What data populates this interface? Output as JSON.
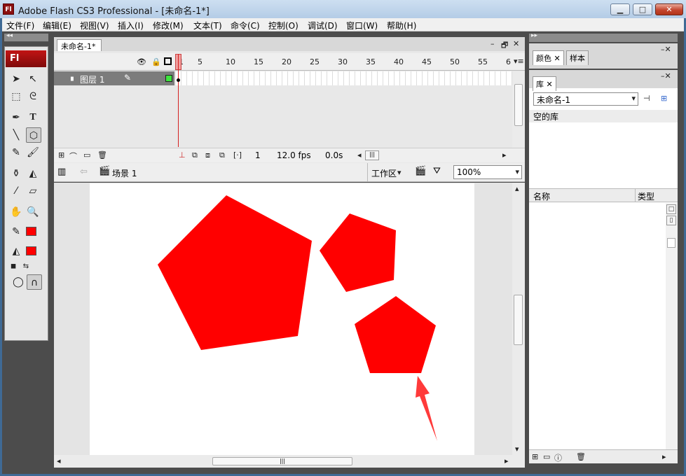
{
  "window": {
    "title": "Adobe Flash CS3 Professional - [未命名-1*]",
    "app_icon": "Fl",
    "minimize_icon": "▁",
    "maximize_icon": "□",
    "close_icon": "✕"
  },
  "menu": [
    "文件(F)",
    "编辑(E)",
    "视图(V)",
    "插入(I)",
    "修改(M)",
    "文本(T)",
    "命令(C)",
    "控制(O)",
    "调试(D)",
    "窗口(W)",
    "帮助(H)"
  ],
  "tools": {
    "badge": "Fl",
    "collapse_icon": "◂◂",
    "stroke_color": "#ff0000",
    "fill_color": "#ff0000"
  },
  "document": {
    "tab_label": "未命名-1*",
    "tab_menu_icon": "▾≡",
    "panel_min_icon": "–",
    "panel_restore_icon": "🗗",
    "panel_close_icon": "✕"
  },
  "timeline": {
    "frame_numbers": [
      "1",
      "5",
      "10",
      "15",
      "20",
      "25",
      "30",
      "35",
      "40",
      "45",
      "50",
      "55",
      "6"
    ],
    "layer_name": "图层 1",
    "current_frame": "1",
    "fps": "12.0 fps",
    "elapsed": "0.0s"
  },
  "editbar": {
    "scene_label": "场景 1",
    "workspace_label": "工作区",
    "zoom_value": "100%"
  },
  "stage": {
    "shape_color": "#ff0000",
    "background": "#ffffff"
  },
  "right_panels": {
    "color_tab": "颜色",
    "swatch_tab": "样本",
    "library_tab": "库",
    "library_doc": "未命名-1",
    "empty_label": "空的库",
    "col_name": "名称",
    "col_type": "类型"
  }
}
